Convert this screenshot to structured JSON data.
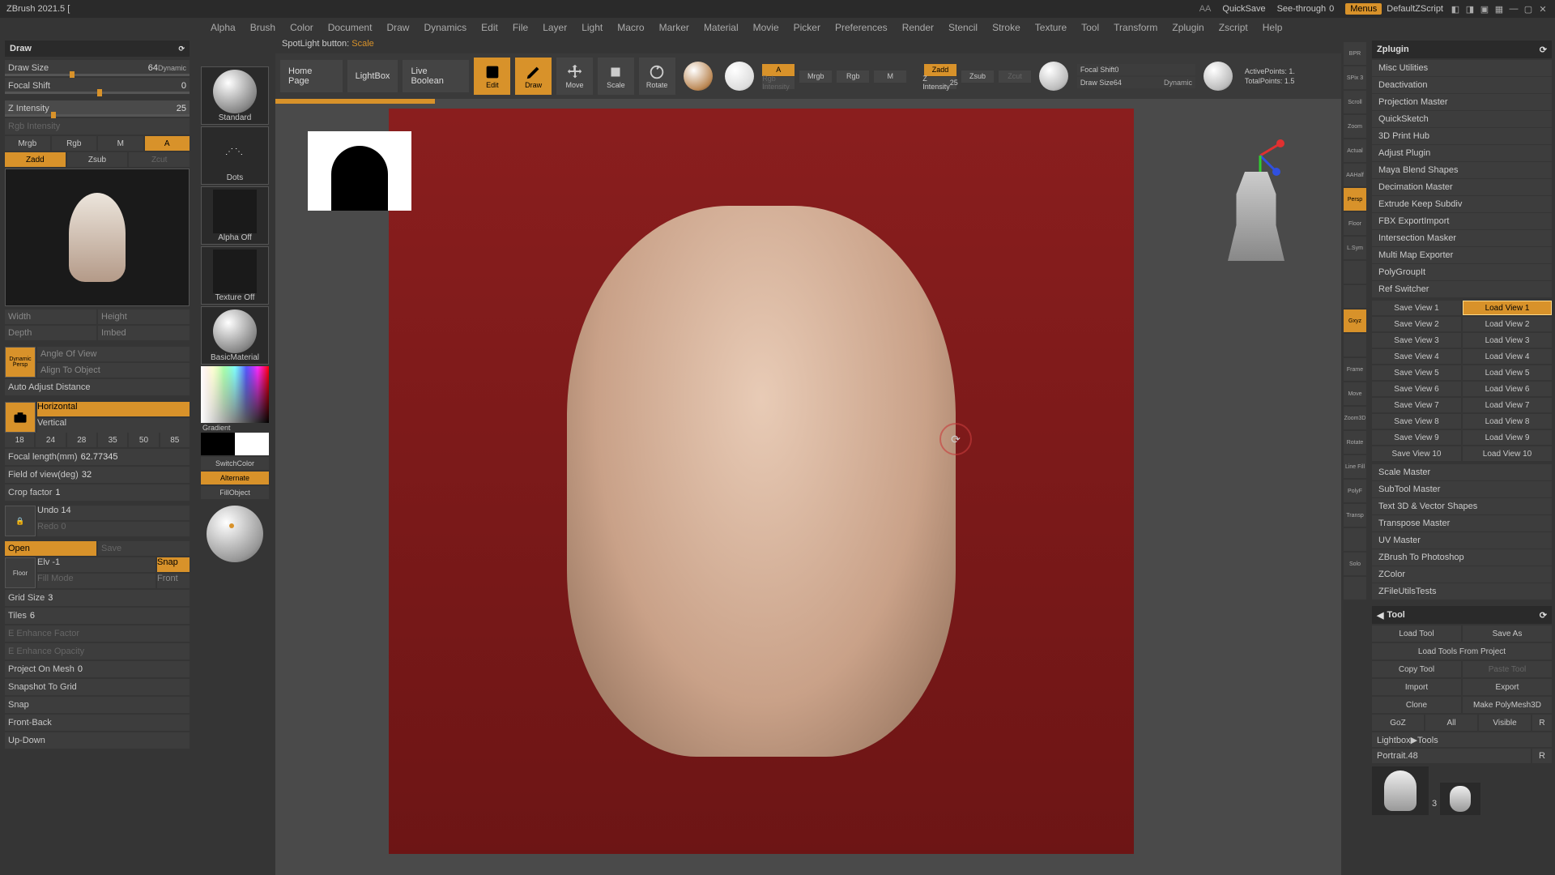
{
  "app": {
    "title": "ZBrush 2021.5 ["
  },
  "titlebar_right": {
    "aa": "AA",
    "quicksave": "QuickSave",
    "see_through": "See-through",
    "see_through_val": "0",
    "menus": "Menus",
    "zscript": "DefaultZScript"
  },
  "menu": [
    "Alpha",
    "Brush",
    "Color",
    "Document",
    "Draw",
    "Dynamics",
    "Edit",
    "File",
    "Layer",
    "Light",
    "Macro",
    "Marker",
    "Material",
    "Movie",
    "Picker",
    "Preferences",
    "Render",
    "Stencil",
    "Stroke",
    "Texture",
    "Tool",
    "Transform",
    "Zplugin",
    "Zscript",
    "Help"
  ],
  "status": {
    "prefix": "SpotLight button: ",
    "value": "Scale"
  },
  "left": {
    "draw_hdr": "Draw",
    "draw_size": {
      "label": "Draw Size",
      "val": "64",
      "dyn": "Dynamic"
    },
    "focal_shift": {
      "label": "Focal Shift",
      "val": "0"
    },
    "zint": {
      "label": "Z Intensity",
      "val": "25"
    },
    "rgbint": "Rgb Intensity",
    "channels": [
      "Mrgb",
      "Rgb",
      "M",
      "A"
    ],
    "channel_on_idx": 3,
    "zmodes": [
      "Zadd",
      "Zsub",
      "Zcut"
    ],
    "zmode_on_idx": 0,
    "dim_labels": {
      "w": "Width",
      "h": "Height",
      "d": "Depth",
      "i": "Imbed"
    },
    "persp": {
      "dyn": "Dynamic",
      "persp": "Persp",
      "angle": "Angle Of View",
      "align": "Align To Object",
      "auto": "Auto Adjust Distance"
    },
    "cam": {
      "h": "Horizontal",
      "v": "Vertical",
      "lenses": [
        "18",
        "24",
        "28",
        "35",
        "50",
        "85"
      ],
      "focal": "Focal length(mm)",
      "focal_v": "62.77345",
      "fov": "Field of view(deg)",
      "fov_v": "32",
      "crop": "Crop factor",
      "crop_v": "1"
    },
    "history": {
      "undo": "Undo 14",
      "redo": "Redo 0"
    },
    "file": {
      "open": "Open",
      "save": "Save",
      "elv": "Elv",
      "elv_v": "-1",
      "snap": "Snap",
      "floor": "Floor",
      "fill": "Fill Mode",
      "front": "Front"
    },
    "grid": {
      "size": "Grid Size",
      "size_v": "3",
      "tiles": "Tiles",
      "tiles_v": "6",
      "enh": "E Enhance Factor",
      "eop": "E Enhance Opacity",
      "pom": "Project On Mesh",
      "pom_v": "0",
      "stg": "Snapshot To Grid",
      "sn": "Snap",
      "fb": "Front-Back",
      "ud": "Up-Down"
    }
  },
  "left_b": {
    "brush": "Standard",
    "stroke": "Dots",
    "alpha": "Alpha Off",
    "texture": "Texture Off",
    "material": "BasicMaterial",
    "gradient": "Gradient",
    "switch": "SwitchColor",
    "alt": "Alternate",
    "fill": "FillObject"
  },
  "shelf": {
    "home": "Home Page",
    "lightbox": "LightBox",
    "live": "Live Boolean",
    "edit": "Edit",
    "draw": "Draw",
    "move": "Move",
    "scale": "Scale",
    "rotate": "Rotate",
    "a": "A",
    "mrgb": "Mrgb",
    "rgb": "Rgb",
    "m": "M",
    "rgbint": "Rgb Intensity",
    "zadd": "Zadd",
    "zsub": "Zsub",
    "zcut": "Zcut",
    "zint": "Z Intensity",
    "zint_v": "25",
    "fs": "Focal Shift",
    "fs_v": "0",
    "ds": "Draw Size",
    "ds_v": "64",
    "dyn": "Dynamic",
    "active": "ActivePoints:",
    "active_v": "1.",
    "total": "TotalPoints:",
    "total_v": "1.5"
  },
  "right_strip": [
    "BPR",
    "SPix 3",
    "Scroll",
    "Zoom",
    "Actual",
    "AAHalf",
    "Persp",
    "Floor",
    "L.Sym",
    "",
    "",
    "Gxyz",
    "",
    "Frame",
    "Move",
    "Zoom3D",
    "Rotate",
    "Line Fill",
    "PolyF",
    "Transp",
    "",
    "Solo",
    ""
  ],
  "right_strip_on": [
    false,
    false,
    false,
    false,
    false,
    false,
    true,
    false,
    false,
    false,
    false,
    true,
    false,
    false,
    false,
    false,
    false,
    false,
    false,
    false,
    false,
    false,
    false
  ],
  "zplugin": {
    "title": "Zplugin",
    "items": [
      "Misc Utilities",
      "Deactivation",
      "Projection Master",
      "QuickSketch",
      "3D Print Hub",
      "Adjust Plugin",
      "Maya Blend Shapes",
      "Decimation Master",
      "Extrude Keep Subdiv",
      "FBX ExportImport",
      "Intersection Masker",
      "Multi Map Exporter",
      "PolyGroupIt",
      "Ref Switcher"
    ],
    "views_save": [
      "Save View 1",
      "Save View 2",
      "Save View 3",
      "Save View 4",
      "Save View 5",
      "Save View 6",
      "Save View 7",
      "Save View 8",
      "Save View 9",
      "Save View 10"
    ],
    "views_load": [
      "Load View 1",
      "Load View 2",
      "Load View 3",
      "Load View 4",
      "Load View 5",
      "Load View 6",
      "Load View 7",
      "Load View 8",
      "Load View 9",
      "Load View 10"
    ],
    "load_on_idx": 0,
    "items2": [
      "Scale Master",
      "SubTool Master",
      "Text 3D & Vector Shapes",
      "Transpose Master",
      "UV Master",
      "ZBrush To Photoshop",
      "ZColor",
      "ZFileUtilsTests"
    ]
  },
  "tool": {
    "title": "Tool",
    "btns": [
      [
        "Load Tool",
        "Save As"
      ],
      [
        "Load Tools From Project",
        ""
      ],
      [
        "Copy Tool",
        "Paste Tool"
      ],
      [
        "Import",
        "Export"
      ],
      [
        "Clone",
        "Make PolyMesh3D"
      ]
    ],
    "row6": [
      "GoZ",
      "All",
      "Visible",
      "R"
    ],
    "lightbox": "Lightbox▶Tools",
    "portrait": "Portrait.",
    "portrait_v": "48",
    "r": "R",
    "poly": "3"
  }
}
